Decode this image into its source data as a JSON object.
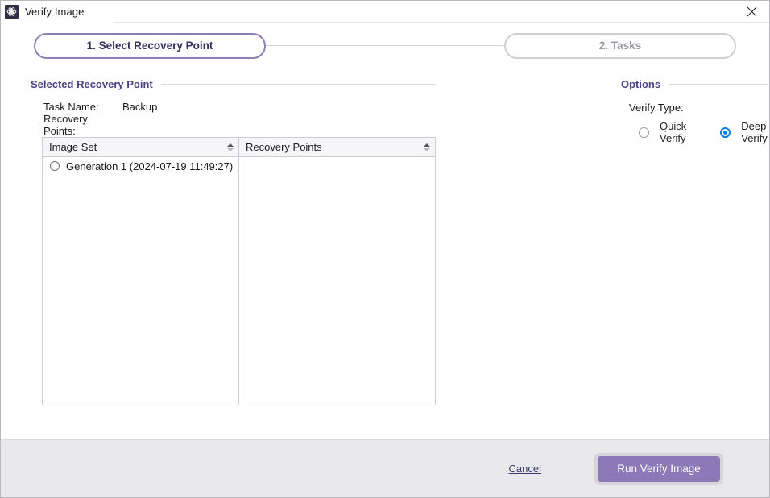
{
  "window": {
    "title": "Verify Image",
    "app_icon": "atom-icon",
    "close_icon": "close-icon"
  },
  "stepper": {
    "steps": [
      {
        "label": "1. Select Recovery Point",
        "state": "active"
      },
      {
        "label": "2. Tasks",
        "state": "inactive"
      }
    ]
  },
  "left_panel": {
    "section_title": "Selected Recovery Point",
    "task_name_label": "Task Name:",
    "task_name_value": "Backup",
    "recovery_points_label": "Recovery Points:",
    "image_set_table": {
      "header": "Image Set",
      "sort_icon": "sort-icon",
      "rows": [
        {
          "label": "Generation 1 (2024-07-19 11:49:27)",
          "selected": false
        }
      ]
    },
    "recovery_points_table": {
      "header": "Recovery Points",
      "sort_icon": "sort-icon",
      "rows": []
    }
  },
  "right_panel": {
    "section_title": "Options",
    "verify_type_label": "Verify Type:",
    "options": [
      {
        "label": "Quick Verify",
        "selected": false
      },
      {
        "label": "Deep Verify",
        "selected": true
      }
    ]
  },
  "footer": {
    "cancel_label": "Cancel",
    "primary_label": "Run Verify Image"
  },
  "colors": {
    "accent_purple": "#4b4289",
    "step_active_border": "#8d7fb4",
    "primary_button": "#8d79b8",
    "radio_blue": "#0b7ee4",
    "footer_bg": "#e9e9eb"
  }
}
